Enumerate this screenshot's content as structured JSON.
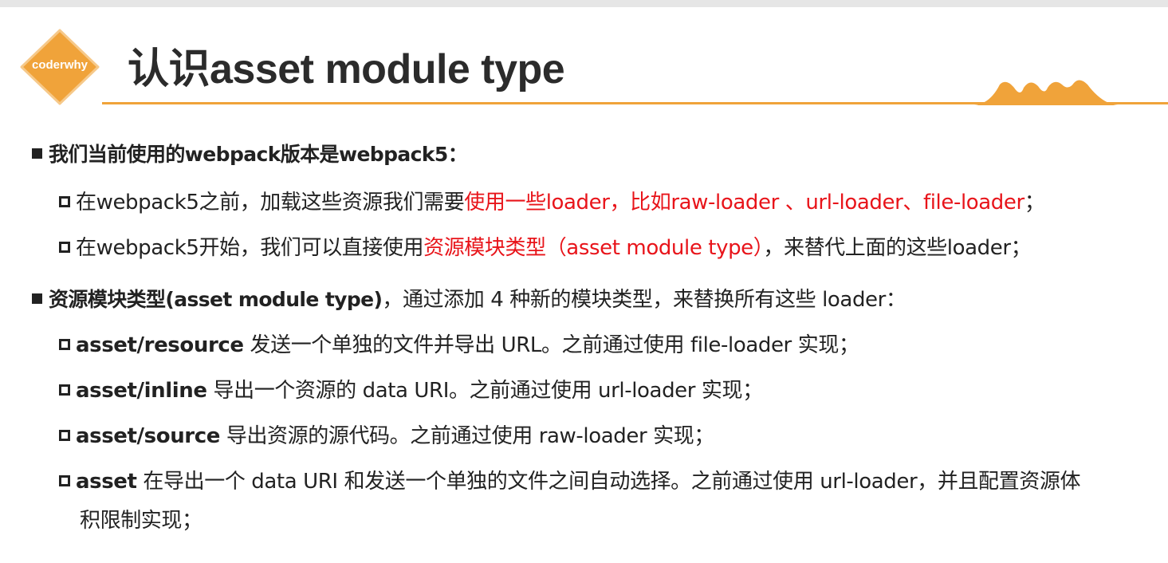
{
  "logo": {
    "text": "coderwhy",
    "color": "#f0a33a"
  },
  "title": "认识asset module type",
  "accent_color": "#f0a33a",
  "highlight_color": "#e8141a",
  "bullet1": {
    "text": "我们当前使用的webpack版本是webpack5：",
    "sub1": {
      "before": "在webpack5之前，加载这些资源我们需要",
      "red": "使用一些loader，比如raw-loader 、url-loader、file-loader",
      "after": "；"
    },
    "sub2": {
      "before": "在webpack5开始，我们可以直接使用",
      "red": "资源模块类型（asset module type）",
      "after": "，来替代上面的这些loader；"
    }
  },
  "bullet2": {
    "bold": "资源模块类型(asset module type)",
    "rest": "，通过添加 4 种新的模块类型，来替换所有这些 loader：",
    "items": [
      {
        "type": "asset/resource",
        "desc": " 发送一个单独的文件并导出 URL。之前通过使用 file-loader 实现；"
      },
      {
        "type": "asset/inline",
        "desc": " 导出一个资源的 data URI。之前通过使用 url-loader 实现；"
      },
      {
        "type": "asset/source",
        "desc": " 导出资源的源代码。之前通过使用 raw-loader 实现；"
      },
      {
        "type": "asset",
        "desc": " 在导出一个 data URI 和发送一个单独的文件之间自动选择。之前通过使用 url-loader，并且配置资源体",
        "cont": "积限制实现；"
      }
    ]
  }
}
